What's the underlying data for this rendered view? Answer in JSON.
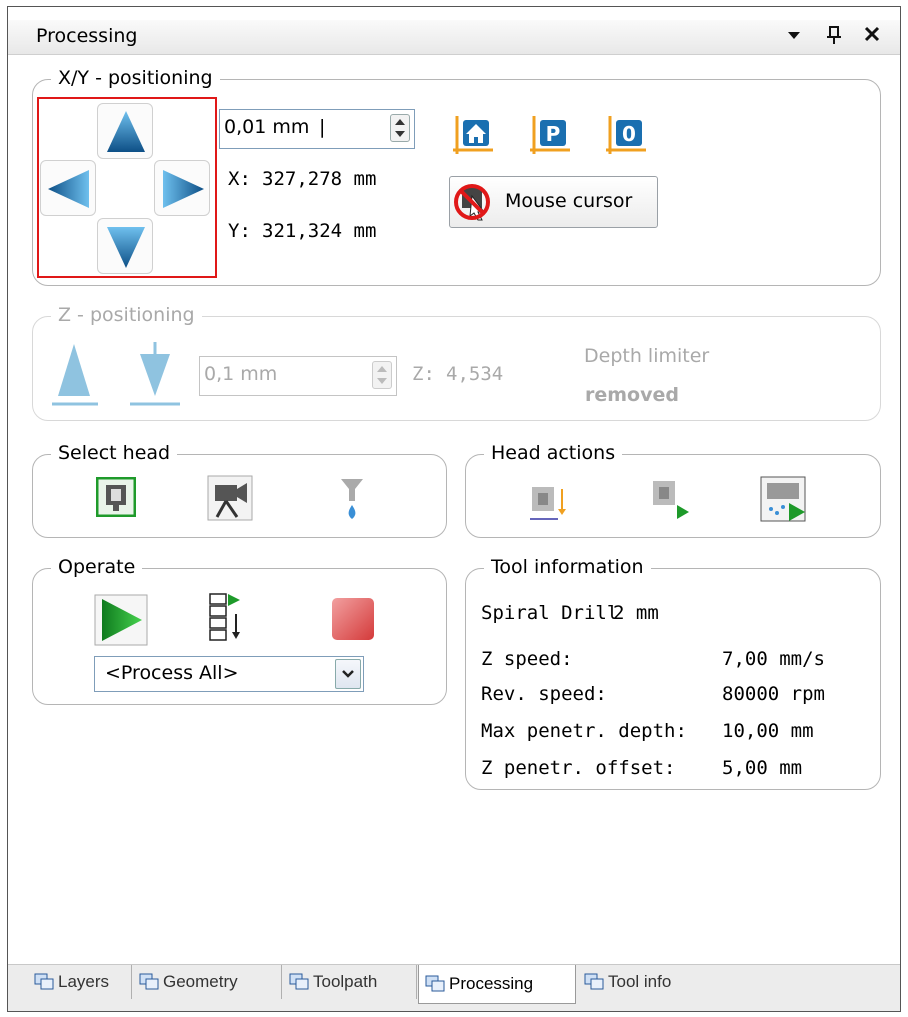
{
  "window": {
    "title": "Processing"
  },
  "xy": {
    "legend": "X/Y - positioning",
    "step": "0,01 mm",
    "x_label": "X:",
    "x_value": "327,278 mm",
    "y_label": "Y:",
    "y_value": "321,324 mm",
    "mouse_cursor": "Mouse cursor"
  },
  "z": {
    "legend": "Z - positioning",
    "step": "0,1 mm",
    "z_label": "Z:",
    "z_value": "4,534",
    "depth_limiter": "Depth limiter",
    "depth_status": "removed"
  },
  "select_head": {
    "legend": "Select head"
  },
  "head_actions": {
    "legend": "Head actions"
  },
  "operate": {
    "legend": "Operate",
    "process_selection": "<Process All>"
  },
  "tool_info": {
    "legend": "Tool information",
    "tool_name": "Spiral Drill",
    "tool_size": "2 mm",
    "rows": [
      {
        "label": "Z speed:",
        "value": "7,00 mm/s"
      },
      {
        "label": "Rev. speed:",
        "value": "80000 rpm"
      },
      {
        "label": "Max penetr. depth:",
        "value": "10,00 mm"
      },
      {
        "label": "Z penetr. offset:",
        "value": "5,00 mm"
      }
    ]
  },
  "tabs": [
    {
      "label": "Layers"
    },
    {
      "label": "Geometry"
    },
    {
      "label": "Toolpath"
    },
    {
      "label": "Processing",
      "active": true
    },
    {
      "label": "Tool info"
    }
  ],
  "colors": {
    "accent_blue": "#1a6fb0",
    "green": "#1e9a2a",
    "orange": "#f0a020",
    "red_box": "#e01818"
  }
}
